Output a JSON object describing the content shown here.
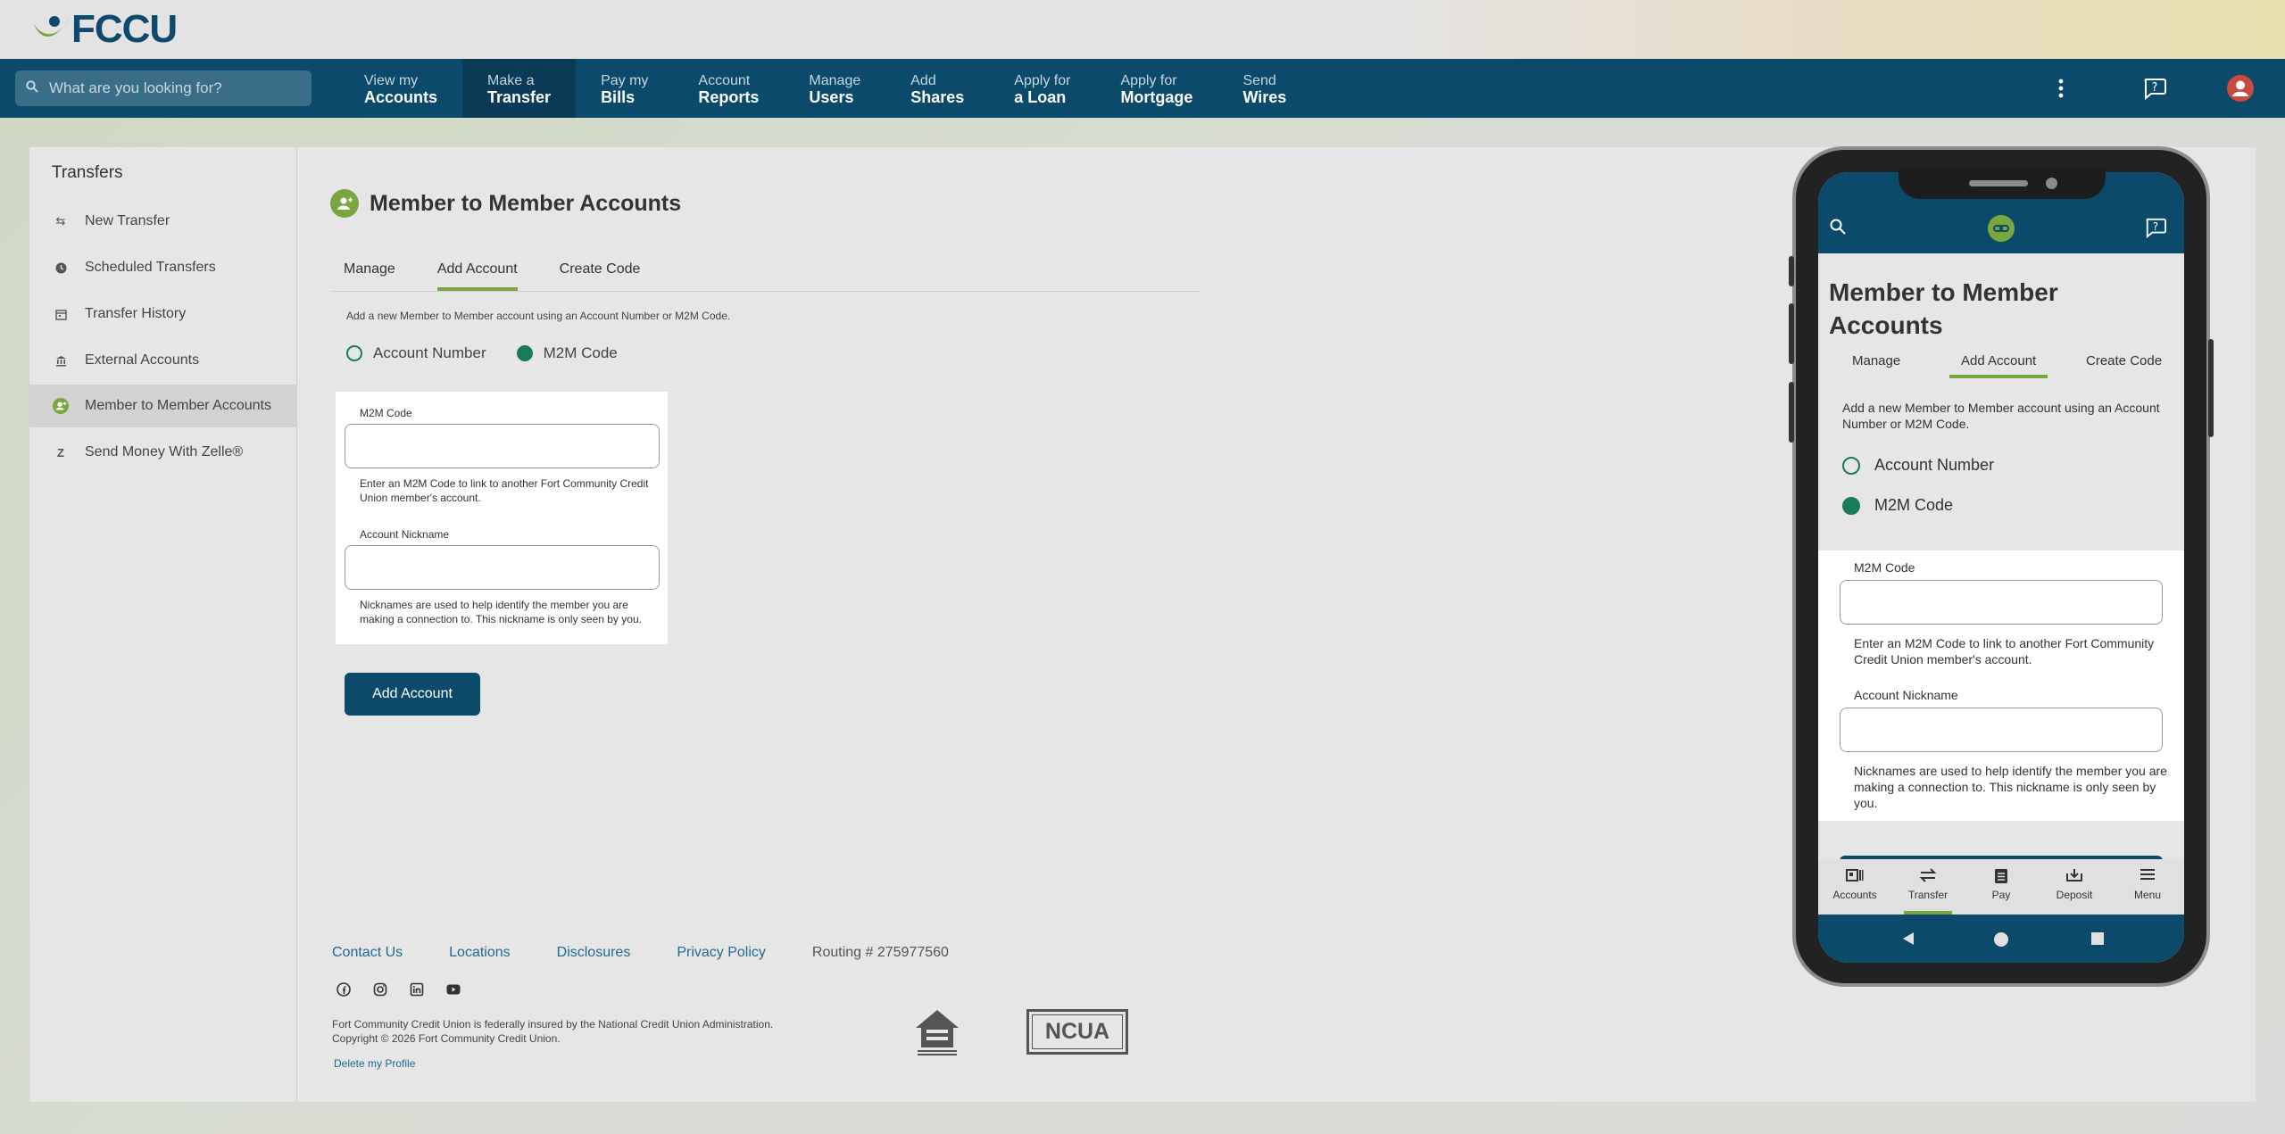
{
  "brand": {
    "name": "FCCU",
    "primary": "#0c4a6b",
    "accent": "#7aa640",
    "radio": "#1c7a5c"
  },
  "search": {
    "placeholder": "What are you looking for?"
  },
  "nav": [
    {
      "l1": "View my",
      "l2": "Accounts"
    },
    {
      "l1": "Make a",
      "l2": "Transfer",
      "active": true
    },
    {
      "l1": "Pay my",
      "l2": "Bills"
    },
    {
      "l1": "Account",
      "l2": "Reports"
    },
    {
      "l1": "Manage",
      "l2": "Users"
    },
    {
      "l1": "Add",
      "l2": "Shares"
    },
    {
      "l1": "Apply for",
      "l2": "a Loan"
    },
    {
      "l1": "Apply for",
      "l2": "Mortgage"
    },
    {
      "l1": "Send",
      "l2": "Wires"
    }
  ],
  "nav_icons": [
    "more-vertical-icon",
    "help-chat-icon",
    "user-avatar-icon"
  ],
  "sidebar": {
    "title": "Transfers",
    "items": [
      {
        "label": "New Transfer",
        "icon": "transfer-icon"
      },
      {
        "label": "Scheduled Transfers",
        "icon": "clock-icon"
      },
      {
        "label": "Transfer History",
        "icon": "calendar-icon"
      },
      {
        "label": "External Accounts",
        "icon": "bank-icon"
      },
      {
        "label": "Member to Member Accounts",
        "icon": "member-icon",
        "active": true
      },
      {
        "label": "Send Money With Zelle®",
        "icon": "zelle-icon"
      }
    ]
  },
  "main": {
    "title": "Member to Member Accounts",
    "tabs": [
      "Manage",
      "Add Account",
      "Create Code"
    ],
    "active_tab": "Add Account",
    "intro": "Add a new Member to Member account using an Account Number or M2M Code.",
    "radios": [
      {
        "label": "Account Number",
        "checked": false
      },
      {
        "label": "M2M Code",
        "checked": true
      }
    ],
    "form": {
      "code_label": "M2M Code",
      "code_value": "",
      "code_help": "Enter an M2M Code to link to another Fort Community Credit Union member's account.",
      "nick_label": "Account Nickname",
      "nick_value": "",
      "nick_help": "Nicknames are used to help identify the member you are making a connection to. This nickname is only seen by you."
    },
    "add_button": "Add Account"
  },
  "footer": {
    "links": [
      "Contact Us",
      "Locations",
      "Disclosures",
      "Privacy Policy"
    ],
    "routing": "Routing # 275977560",
    "social": [
      "facebook-icon",
      "instagram-icon",
      "linkedin-icon",
      "youtube-icon"
    ],
    "insured": "Fort Community Credit Union is federally insured by the National Credit Union Administration.",
    "copyright": "Copyright © 2026 Fort Community Credit Union.",
    "delete_profile": "Delete my Profile",
    "ncua": "NCUA"
  },
  "phone": {
    "title": "Member to Member Accounts",
    "tabs": [
      "Manage",
      "Add Account",
      "Create Code"
    ],
    "intro": "Add a new Member to Member account using an Account Number or M2M Code.",
    "radios": [
      "Account Number",
      "M2M Code"
    ],
    "code_label": "M2M Code",
    "code_help": "Enter an M2M Code to link to another Fort Community Credit Union member's account.",
    "nick_label": "Account Nickname",
    "nick_help": "Nicknames are used to help identify the member you are making a connection to. This nickname is only seen by you.",
    "bottom_nav": [
      "Accounts",
      "Transfer",
      "Pay",
      "Deposit",
      "Menu"
    ],
    "active_bottom": "Transfer"
  }
}
